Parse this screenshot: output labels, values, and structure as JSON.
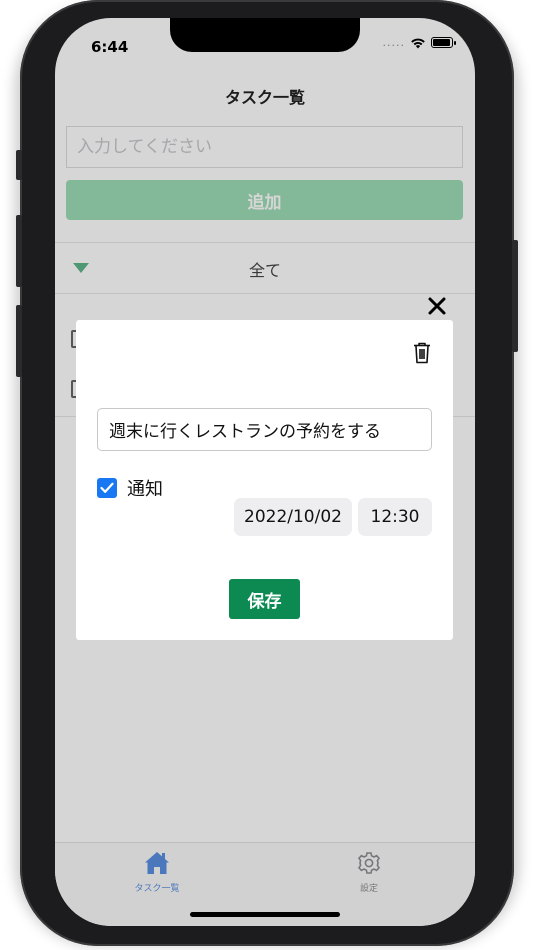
{
  "status_bar": {
    "time": "6:44",
    "signal": "....."
  },
  "header": {
    "title": "タスク一覧"
  },
  "task_form": {
    "placeholder": "入力してください",
    "add_label": "追加"
  },
  "filter": {
    "label": "全て"
  },
  "modal": {
    "task_title": "週末に行くレストランの予約をする",
    "notify_label": "通知",
    "notify_checked": true,
    "date": "2022/10/02",
    "time": "12:30",
    "save_label": "保存"
  },
  "tabbar": {
    "tabs": [
      {
        "label": "タスク一覧",
        "icon": "home-icon",
        "active": true
      },
      {
        "label": "設定",
        "icon": "gear-icon",
        "active": false
      }
    ]
  },
  "colors": {
    "accent_green": "#0d8a52",
    "add_button": "#9ddcb5",
    "tab_active": "#5a8fe0",
    "checkbox_blue": "#1877f2"
  }
}
